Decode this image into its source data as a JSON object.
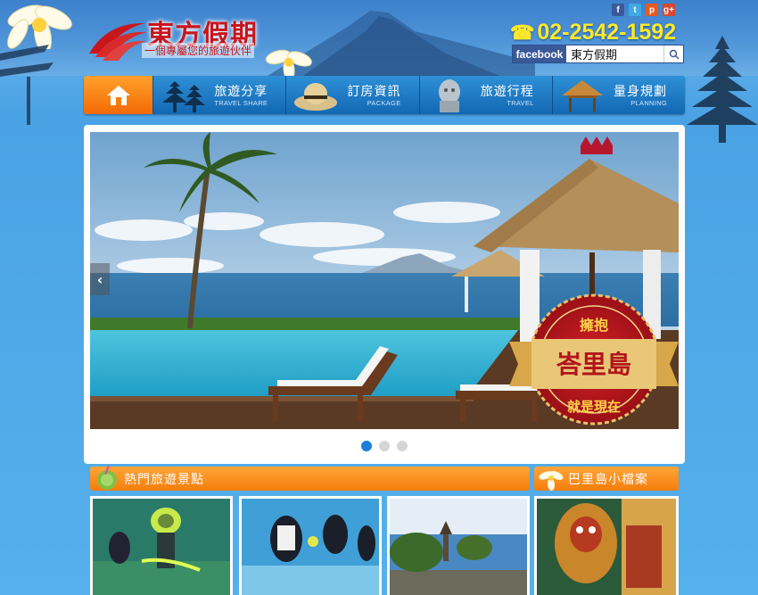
{
  "header": {
    "logo_title": "東方假期",
    "logo_slogan": "一個專屬您的旅遊伙伴",
    "phone": "02-2542-1592",
    "social_icons": [
      "facebook-icon",
      "twitter-icon",
      "plurk-icon",
      "google-plus-icon"
    ],
    "social_glyphs": [
      "f",
      "t",
      "p",
      "g+"
    ],
    "social_colors": [
      "#3b5998",
      "#3fa9e3",
      "#e8581e",
      "#d6472f"
    ],
    "facebook_label": "facebook",
    "facebook_search_value": "東方假期"
  },
  "nav": {
    "home_icon": "home-icon",
    "items": [
      {
        "label": "旅遊分享",
        "sub": "TRAVEL SHARE"
      },
      {
        "label": "訂房資訊",
        "sub": "PACKAGE"
      },
      {
        "label": "旅遊行程",
        "sub": "TRAVEL"
      },
      {
        "label": "量身規劃",
        "sub": "PLANNING"
      }
    ]
  },
  "slider": {
    "badge_top": "擁抱",
    "badge_main": "峇里島",
    "badge_bottom": "就是現在",
    "prev_icon": "chevron-left-icon",
    "next_icon": "chevron-right-icon",
    "dot_count": 3,
    "active_dot": 0
  },
  "sections": {
    "popular_title": "熱門旅遊景點",
    "bali_title": "巴里島小檔案"
  },
  "colors": {
    "accent_orange": "#f57d0a",
    "nav_blue": "#1368b3",
    "logo_red": "#c8161d",
    "phone_yellow": "#ffe92a"
  }
}
